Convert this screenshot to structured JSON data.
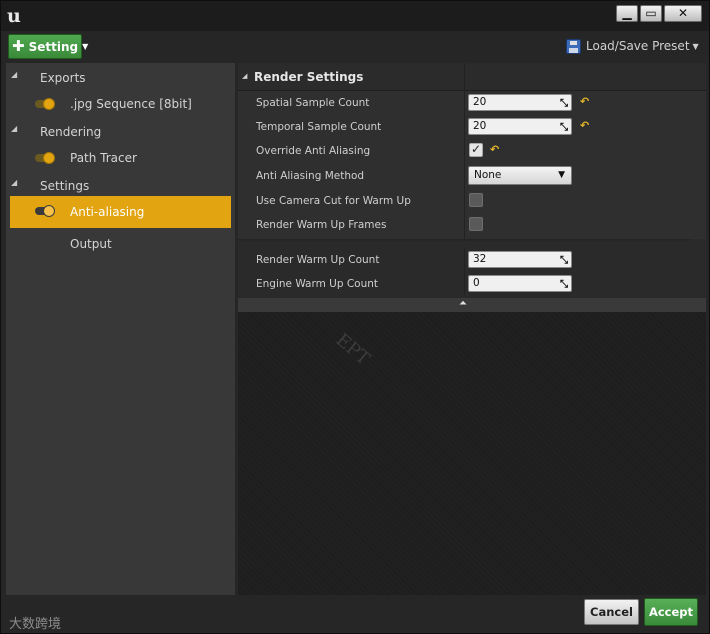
{
  "window": {
    "logo_text": "u",
    "minimize_glyph": "▁",
    "maximize_glyph": "▭",
    "close_glyph": "✕"
  },
  "toolbar": {
    "add_setting_label": "Setting",
    "add_setting_icon": "plus-icon",
    "preset_label": "Load/Save Preset",
    "preset_icon": "floppy-disk-icon"
  },
  "sidebar": {
    "groups": [
      {
        "label": "Exports",
        "items": [
          {
            "label": ".jpg Sequence [8bit]",
            "enabled": true
          }
        ]
      },
      {
        "label": "Rendering",
        "items": [
          {
            "label": "Path Tracer",
            "enabled": true
          }
        ]
      },
      {
        "label": "Settings",
        "items": [
          {
            "label": "Anti-aliasing",
            "enabled": true,
            "selected": true
          },
          {
            "label": "Output",
            "enabled": false
          }
        ]
      }
    ]
  },
  "details": {
    "section_title": "Render Settings",
    "properties": [
      {
        "label": "Spatial Sample Count",
        "type": "number",
        "value": "20",
        "modified": true
      },
      {
        "label": "Temporal Sample Count",
        "type": "number",
        "value": "20",
        "modified": true
      },
      {
        "label": "Override Anti Aliasing",
        "type": "checkbox",
        "checked": true,
        "modified": true
      },
      {
        "label": "Anti Aliasing Method",
        "type": "combo",
        "value": "None"
      },
      {
        "label": "Use Camera Cut for Warm Up",
        "type": "checkbox",
        "checked": false
      },
      {
        "label": "Render Warm Up Frames",
        "type": "checkbox",
        "checked": false
      }
    ],
    "advanced_properties": [
      {
        "label": "Render Warm Up Count",
        "type": "number",
        "value": "32"
      },
      {
        "label": "Engine Warm Up Count",
        "type": "number",
        "value": "0"
      }
    ]
  },
  "watermark": "EPT",
  "footer": {
    "brand": "大数跨境",
    "cancel_label": "Cancel",
    "accept_label": "Accept"
  },
  "colors": {
    "accent": "#e2a410",
    "accept_green": "#3a8a3a",
    "reset_yellow": "#e2b72a"
  }
}
